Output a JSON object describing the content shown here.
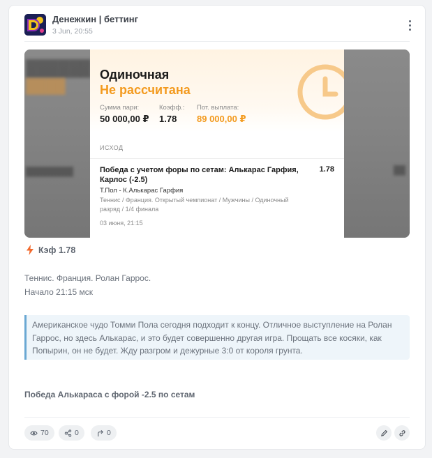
{
  "post": {
    "channel_name": "Денежкин | беттинг",
    "date": "3 Jun, 20:55"
  },
  "bet_slip": {
    "type": "Одиночная",
    "status": "Не рассчитана",
    "stake_label": "Сумма пари:",
    "stake_value": "50 000,00 ₽",
    "odds_label": "Коэфф.:",
    "odds_value": "1.78",
    "payout_label": "Пот. выплата:",
    "payout_value": "89 000,00 ₽",
    "outcome_header": "ИСХОД",
    "selection": "Победа с учетом форы по сетам: Алькарас Гарфия, Карлос (-2.5)",
    "selection_odds": "1.78",
    "match": "Т.Пол - К.Алькарас Гарфия",
    "league": "Теннис / Франция. Открытый чемпионат / Мужчины / Одиночный разряд / 1/4 финала",
    "time": "03 июня, 21:15"
  },
  "odds_badge": "Кэф 1.78",
  "body_lines": [
    "Теннис. Франция. Ролан Гаррос.",
    "Начало 21:15 мск"
  ],
  "quote": "Американское чудо Томми Пола сегодня подходит к концу. Отличное выступление на Ролан Гаррос, но здесь Алькарас, и это будет совершенно другая игра. Прощать все косяки, как Попырин, он не будет. Жду разгром и дежурные 3:0 от короля грунта.",
  "summary": "Победа Алькараса с форой -2.5 по сетам",
  "stats": {
    "views": "70",
    "shares": "0",
    "forwards": "0"
  },
  "colors": {
    "accent_orange": "#f39a1e",
    "quote_border": "#6aa8d3",
    "bolt": "#f26a2e"
  },
  "icons": [
    "eye-icon",
    "share-icon",
    "forward-icon",
    "pencil-icon",
    "link-icon",
    "lightning-icon",
    "clock-icon",
    "more-vertical-icon"
  ]
}
